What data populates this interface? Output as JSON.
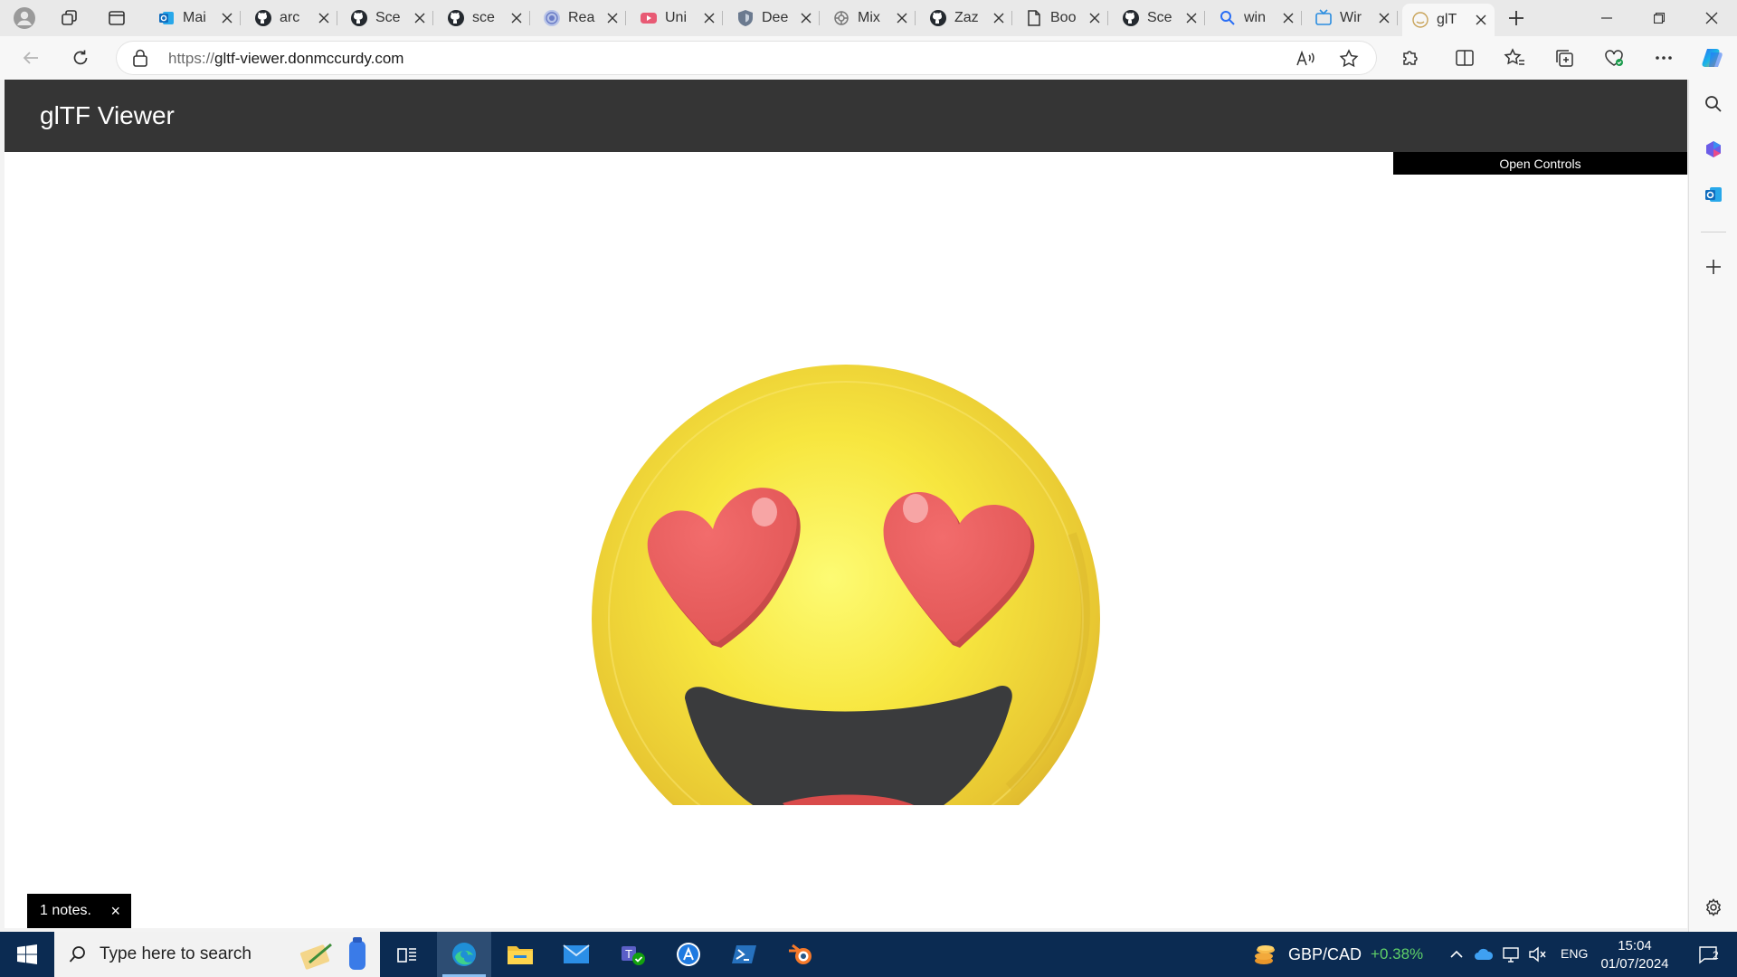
{
  "browser": {
    "tabs": [
      {
        "title": "Mai",
        "favicon": "outlook-icon"
      },
      {
        "title": "arc",
        "favicon": "github-icon"
      },
      {
        "title": "Sce",
        "favicon": "github-icon"
      },
      {
        "title": "sce",
        "favicon": "github-icon"
      },
      {
        "title": "Rea",
        "favicon": "globe-icon"
      },
      {
        "title": "Uni",
        "favicon": "youtube-icon"
      },
      {
        "title": "Dee",
        "favicon": "shield-icon"
      },
      {
        "title": "Mix",
        "favicon": "openai-icon"
      },
      {
        "title": "Zaz",
        "favicon": "github-icon"
      },
      {
        "title": "Boo",
        "favicon": "document-icon"
      },
      {
        "title": "Sce",
        "favicon": "github-icon"
      },
      {
        "title": "win",
        "favicon": "search-icon"
      },
      {
        "title": "Wir",
        "favicon": "tv-icon"
      },
      {
        "title": "glT",
        "favicon": "gltf-icon",
        "active": true
      }
    ],
    "url_scheme": "https://",
    "url_host": "gltf-viewer.donmccurdy.com"
  },
  "page": {
    "title": "glTF Viewer",
    "open_controls_label": "Open Controls",
    "notes_label": "1 notes.",
    "notes_close": "×",
    "model": "smiling-face-with-heart-eyes-emoji",
    "colors": {
      "header": "#353535",
      "face": "#f6e23a",
      "hearts": "#ee5a5a",
      "mouth": "#3a3b3d",
      "tongue": "#d94b4b"
    }
  },
  "taskbar": {
    "search_placeholder": "Type here to search",
    "ticker_symbol": "GBP/CAD",
    "ticker_change": "+0.38%",
    "language": "ENG",
    "time": "15:04",
    "date": "01/07/2024",
    "notification_count": "2",
    "accent": "#0b2b52"
  }
}
